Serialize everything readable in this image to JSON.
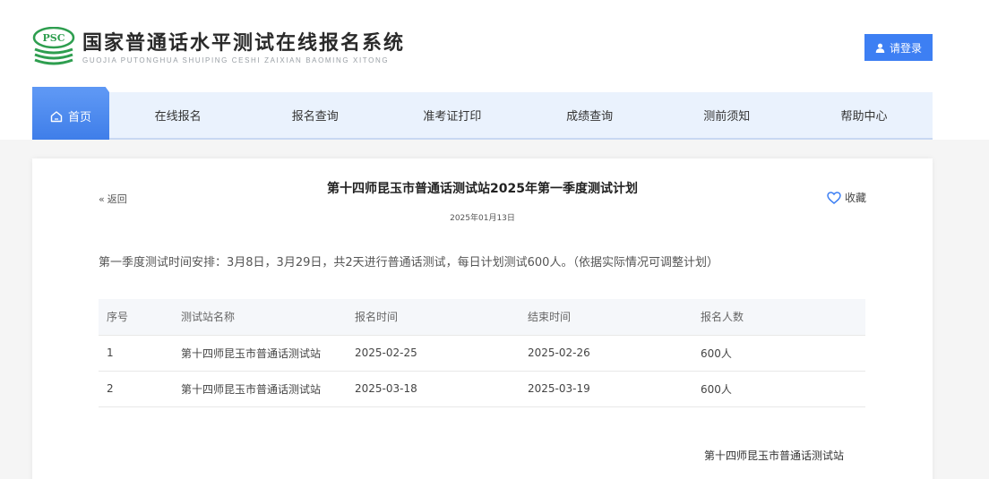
{
  "header": {
    "logo_badge": "PSC",
    "title": "国家普通话水平测试在线报名系统",
    "subtitle": "GUOJIA PUTONGHUA SHUIPING CESHI ZAIXIAN BAOMING XITONG",
    "login_label": "请登录"
  },
  "nav": {
    "home": "首页",
    "items": [
      "在线报名",
      "报名查询",
      "准考证打印",
      "成绩查询",
      "测前须知",
      "帮助中心"
    ]
  },
  "article": {
    "back_label": "返回",
    "favorite_label": "收藏",
    "title": "第十四师昆玉市普通话测试站2025年第一季度测试计划",
    "date": "2025年01月13日",
    "intro": "第一季度测试时间安排：3月8日，3月29日，共2天进行普通话测试，每日计划测试600人。（依据实际情况可调整计划）",
    "table": {
      "headers": [
        "序号",
        "测试站名称",
        "报名时间",
        "结束时间",
        "报名人数"
      ],
      "rows": [
        [
          "1",
          "第十四师昆玉市普通话测试站",
          "2025-02-25",
          "2025-02-26",
          "600人"
        ],
        [
          "2",
          "第十四师昆玉市普通话测试站",
          "2025-03-18",
          "2025-03-19",
          "600人"
        ]
      ]
    },
    "signature": "第十四师昆玉市普通话测试站"
  },
  "colors": {
    "accent": "#3d7ff3",
    "logo_green": "#2e9e4f",
    "nav_bg": "#eaf2fd"
  }
}
